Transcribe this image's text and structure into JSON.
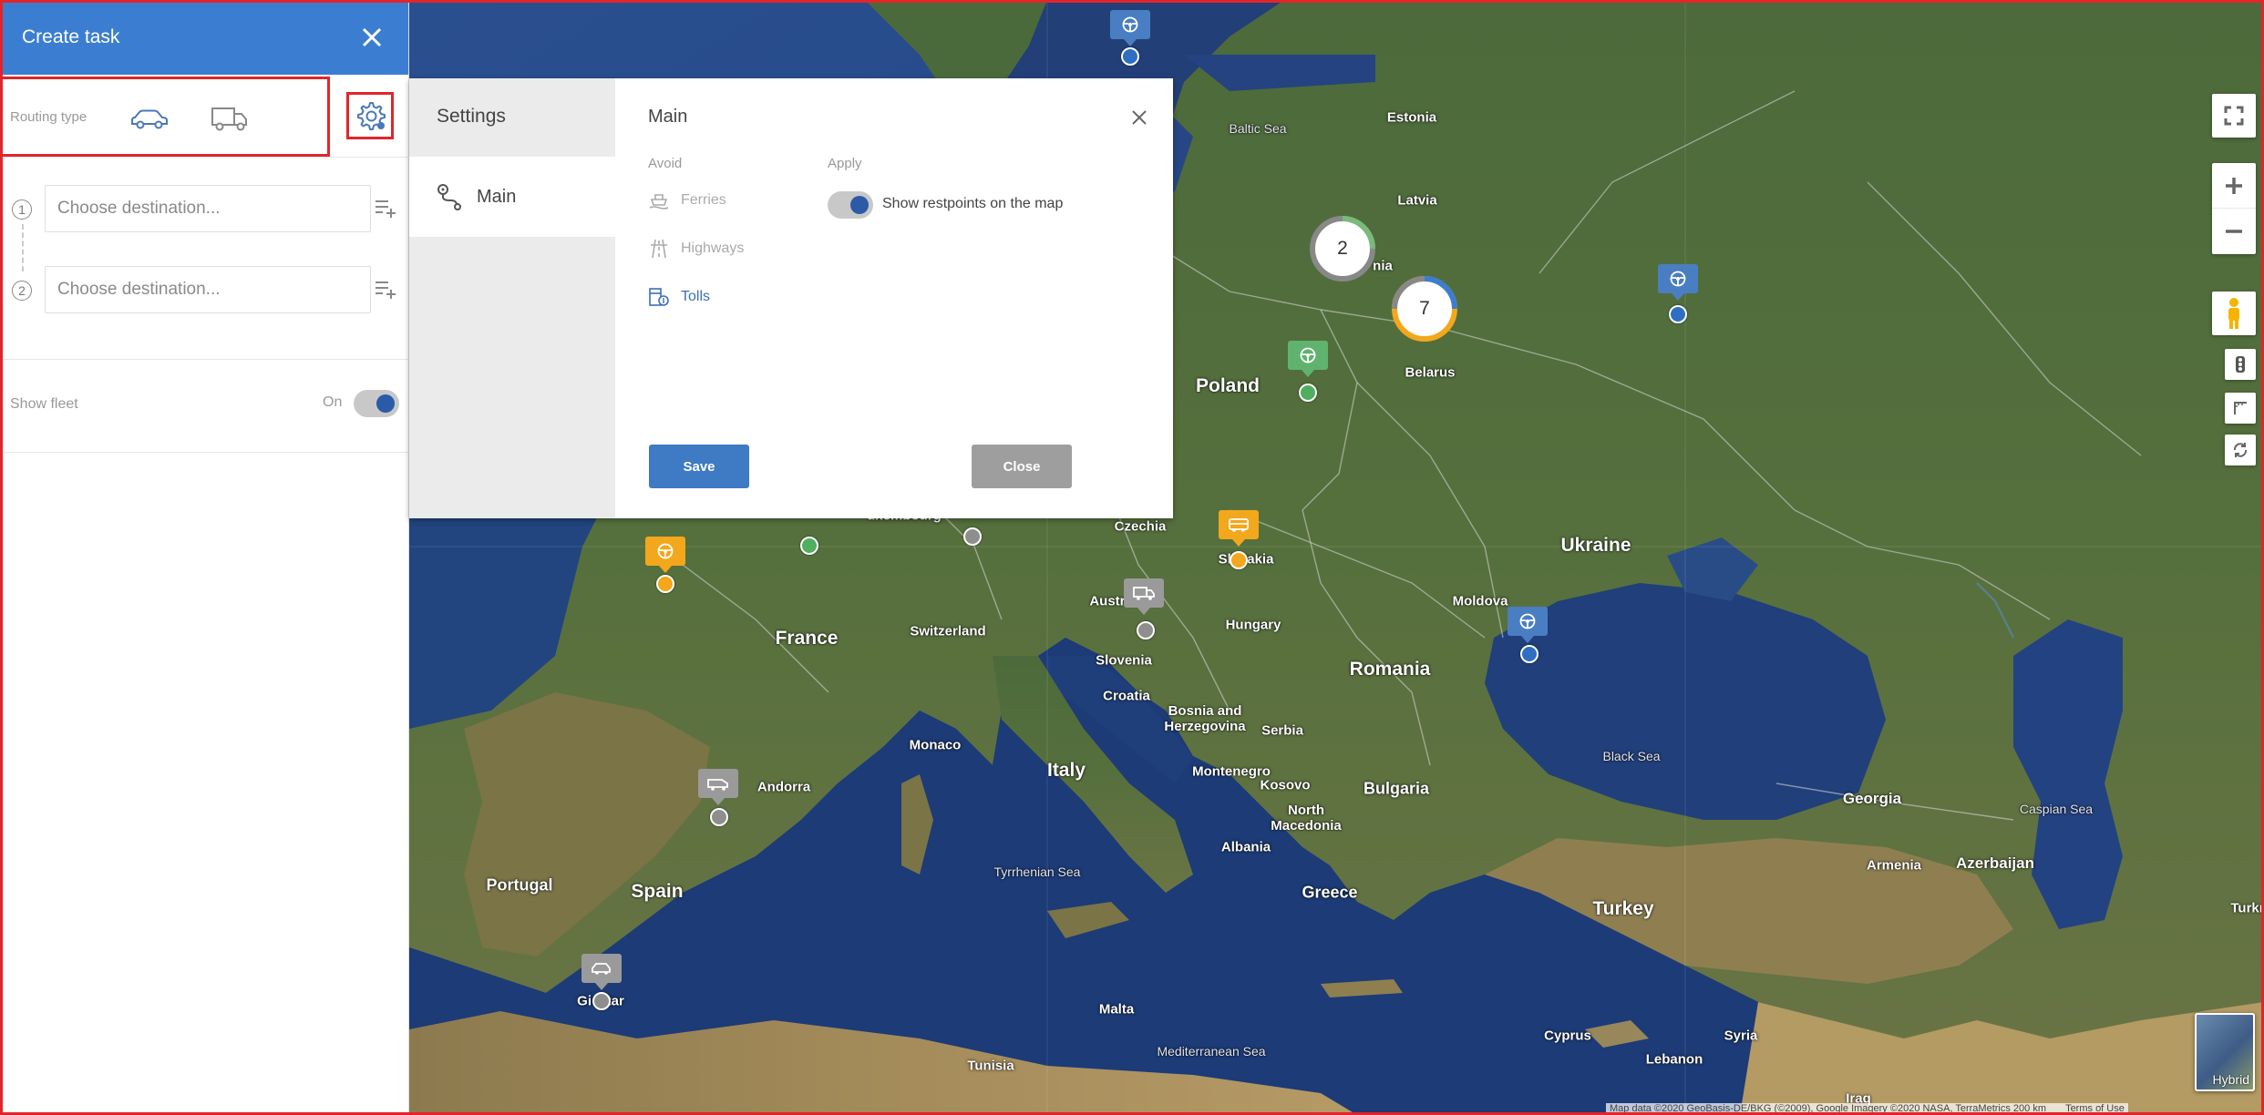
{
  "panel": {
    "title": "Create task",
    "routing_label": "Routing type",
    "routing_types": [
      "car-icon",
      "truck-icon"
    ],
    "destinations": [
      {
        "num": "1",
        "placeholder": "Choose destination..."
      },
      {
        "num": "2",
        "placeholder": "Choose destination..."
      }
    ],
    "show_fleet_label": "Show fleet",
    "show_fleet_state": "On"
  },
  "settings": {
    "heading": "Settings",
    "tab_main": "Main",
    "section_title": "Main",
    "avoid_heading": "Avoid",
    "apply_heading": "Apply",
    "avoid_items": {
      "ferries": "Ferries",
      "highways": "Highways",
      "tolls": "Tolls"
    },
    "apply_option": "Show restpoints on the map",
    "save_label": "Save",
    "close_label": "Close"
  },
  "map": {
    "labels": {
      "estonia": "Estonia",
      "latvia": "Latvia",
      "lithuania_part": "nia",
      "baltic_sea": "Baltic Sea",
      "poland": "Poland",
      "belarus": "Belarus",
      "ukraine": "Ukraine",
      "czechia": "Czechia",
      "slovakia": "Slovakia",
      "austria": "Austri",
      "hungary": "Hungary",
      "moldova": "Moldova",
      "france": "France",
      "switzerland": "Switzerland",
      "slovenia": "Slovenia",
      "croatia": "Croatia",
      "romania": "Romania",
      "bosnia": "Bosnia and\nHerzegovina",
      "serbia": "Serbia",
      "monaco": "Monaco",
      "italy": "Italy",
      "andorra": "Andorra",
      "montenegro": "Montenegro",
      "kosovo": "Kosovo",
      "bulgaria": "Bulgaria",
      "north_macedonia": "North\nMacedonia",
      "black_sea": "Black Sea",
      "georgia": "Georgia",
      "caspian_sea": "Caspian Sea",
      "armenia": "Armenia",
      "azerbaijan": "Azerbaijan",
      "portugal": "Portugal",
      "spain": "Spain",
      "tyrrhenian": "Tyrrhenian Sea",
      "albania": "Albania",
      "greece": "Greece",
      "turkey": "Turkey",
      "turkmen_part": "Turkr",
      "gibraltar_part": "Gi    tar",
      "malta": "Malta",
      "tunisia": "Tunisia",
      "mediterranean": "Mediterranean Sea",
      "cyprus": "Cyprus",
      "syria": "Syria",
      "lebanon": "Lebanon",
      "iraq": "Iraq",
      "luxembourg_part": "uxembourg"
    },
    "clusters": [
      {
        "count": "2",
        "colors": [
          "#7aba7a",
          "#888888"
        ]
      },
      {
        "count": "7",
        "colors": [
          "#3b7ed1",
          "#f3a71c"
        ]
      }
    ],
    "attribution": "Map data ©2020 GeoBasis-DE/BKG (©2009), Google Imagery ©2020 NASA, TerraMetrics   200 km",
    "terms": "Terms of Use",
    "layer_button": "Hybrid"
  }
}
